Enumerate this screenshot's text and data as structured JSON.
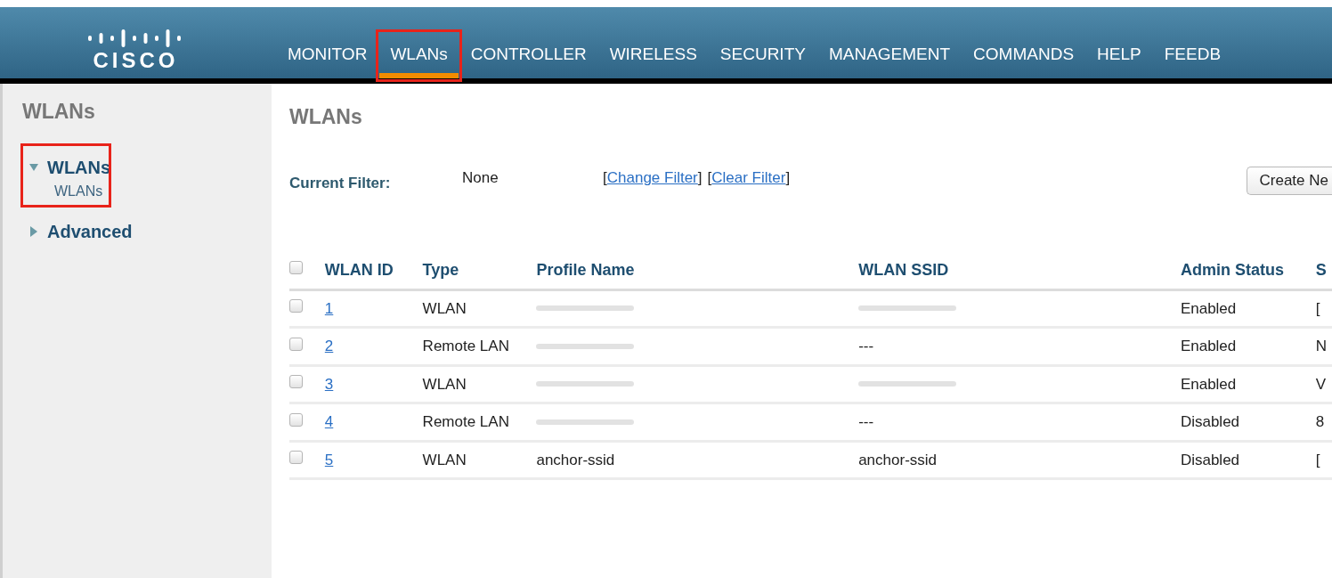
{
  "header": {
    "logo": {
      "text": "CISCO"
    },
    "menu": [
      {
        "label": "MONITOR",
        "selected": false,
        "highlighted": false
      },
      {
        "label": "WLANs",
        "selected": true,
        "highlighted": true
      },
      {
        "label": "CONTROLLER",
        "selected": false,
        "highlighted": false
      },
      {
        "label": "WIRELESS",
        "selected": false,
        "highlighted": false
      },
      {
        "label": "SECURITY",
        "selected": false,
        "highlighted": false
      },
      {
        "label": "MANAGEMENT",
        "selected": false,
        "highlighted": false
      },
      {
        "label": "COMMANDS",
        "selected": false,
        "highlighted": false
      },
      {
        "label": "HELP",
        "selected": false,
        "highlighted": false
      },
      {
        "label": "FEEDB",
        "selected": false,
        "highlighted": false
      }
    ]
  },
  "sidebar": {
    "title": "WLANs",
    "items": [
      {
        "label": "WLANs",
        "expanded": true,
        "highlighted": true,
        "children": [
          {
            "label": "WLANs"
          }
        ]
      },
      {
        "label": "Advanced",
        "expanded": false,
        "highlighted": false
      }
    ]
  },
  "content": {
    "title": "WLANs",
    "filter": {
      "label": "Current Filter:",
      "value": "None",
      "links": [
        {
          "open": "[",
          "text": "Change Filter",
          "close": "]"
        },
        {
          "open": "[",
          "text": "Clear Filter",
          "close": "]"
        }
      ]
    },
    "create_button": "Create Ne",
    "table": {
      "select_all_checked": false,
      "columns": [
        "WLAN ID",
        "Type",
        "Profile Name",
        "WLAN SSID",
        "Admin Status",
        "S"
      ],
      "rows": [
        {
          "checked": false,
          "wlan_id": "1",
          "type": "WLAN",
          "profile": {
            "redacted": true
          },
          "ssid": {
            "redacted": true
          },
          "admin_status": "Enabled",
          "column_6": "["
        },
        {
          "checked": false,
          "wlan_id": "2",
          "type": "Remote LAN",
          "profile": {
            "redacted": true
          },
          "ssid": {
            "text": "---"
          },
          "admin_status": "Enabled",
          "column_6": "N"
        },
        {
          "checked": false,
          "wlan_id": "3",
          "type": "WLAN",
          "profile": {
            "redacted": true
          },
          "ssid": {
            "redacted": true
          },
          "admin_status": "Enabled",
          "column_6": "V"
        },
        {
          "checked": false,
          "wlan_id": "4",
          "type": "Remote LAN",
          "profile": {
            "redacted": true
          },
          "ssid": {
            "text": "---"
          },
          "admin_status": "Disabled",
          "column_6": "8"
        },
        {
          "checked": false,
          "wlan_id": "5",
          "type": "WLAN",
          "profile": {
            "text": "anchor-ssid"
          },
          "ssid": {
            "text": "anchor-ssid"
          },
          "admin_status": "Disabled",
          "column_6": "["
        }
      ]
    }
  }
}
